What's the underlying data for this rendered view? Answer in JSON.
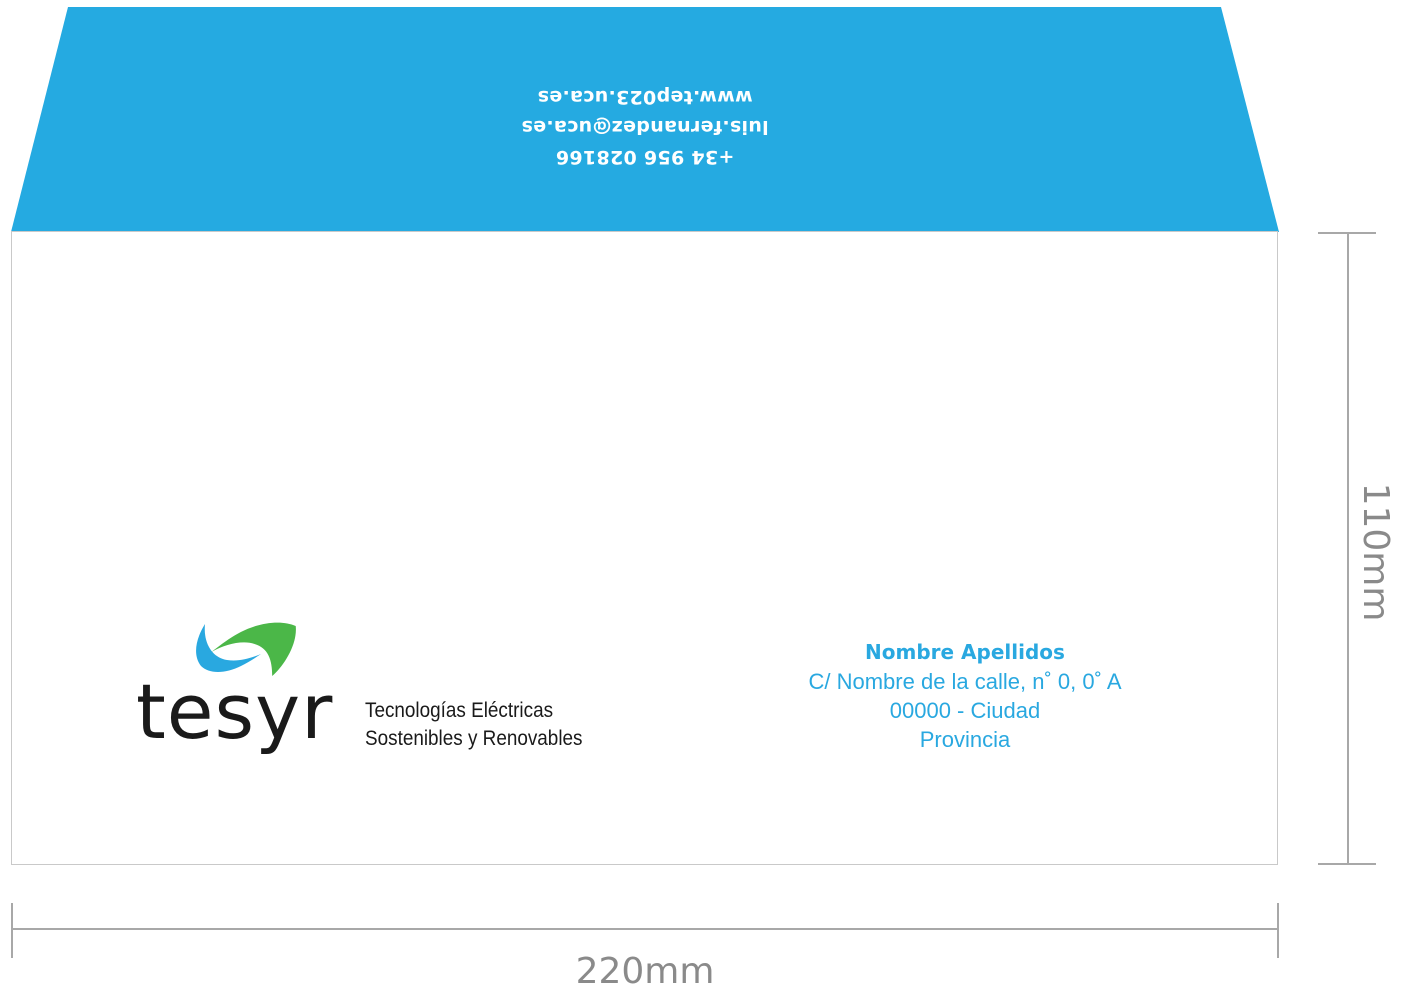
{
  "flap": {
    "color": "#25aae1",
    "lines": [
      "+34 956 028166",
      "luis.fernandez@uca.es",
      "www.tep023.uca.es"
    ]
  },
  "logo": {
    "wordmark": "tesyr",
    "tagline_line1": "Tecnologías Eléctricas",
    "tagline_line2": "Sostenibles y Renovables",
    "colors": {
      "blue": "#29a8e0",
      "green": "#4bb748",
      "text": "#1a1a1a"
    }
  },
  "address": {
    "name": "Nombre Apellidos",
    "street": "C/ Nombre de la calle, n˚ 0, 0˚ A",
    "postal_city": "00000 - Ciudad",
    "province": "Provincia",
    "color": "#29a8e0"
  },
  "dimensions": {
    "width_label": "220mm",
    "height_label": "110mm"
  }
}
